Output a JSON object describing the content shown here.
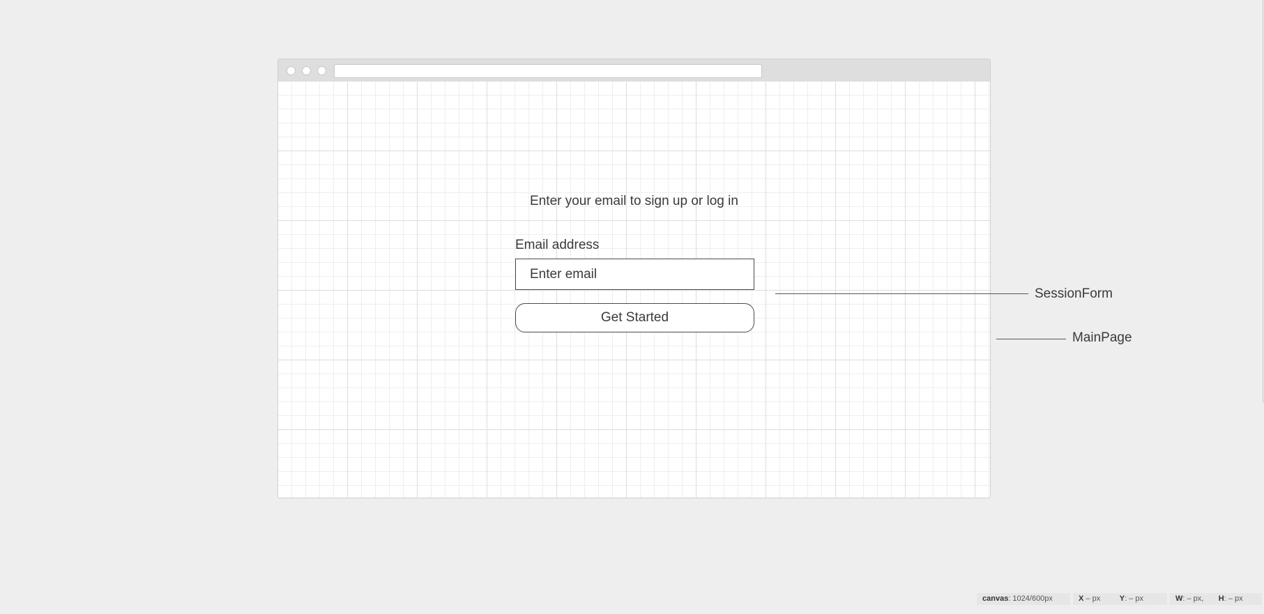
{
  "heading": "Enter your email to sign up or log in",
  "form": {
    "email_label": "Email address",
    "email_placeholder": "Enter email",
    "email_value": "",
    "submit_label": "Get Started"
  },
  "annotations": {
    "session_form": "SessionForm",
    "main_page": "MainPage"
  },
  "status_bar": {
    "canvas_label": "canvas",
    "canvas_value": ": 1024/600px",
    "x_label": "X",
    "x_value": " – px",
    "y_label": "Y",
    "y_value": ": – px",
    "w_label": "W",
    "w_value": ": – px,",
    "h_label": "H",
    "h_value": ": – px"
  }
}
